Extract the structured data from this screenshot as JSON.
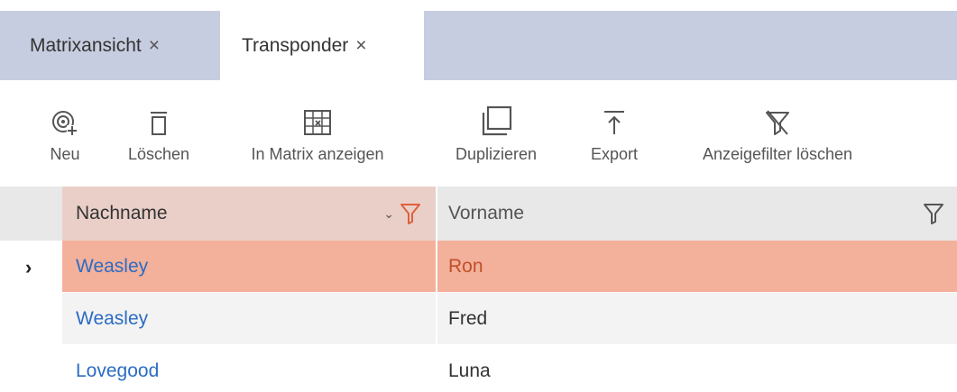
{
  "tabs": [
    {
      "label": "Matrixansicht",
      "close": "×",
      "active": false
    },
    {
      "label": "Transponder",
      "close": "×",
      "active": true
    }
  ],
  "toolbar": {
    "new_label": "Neu",
    "delete_label": "Löschen",
    "show_in_matrix_label": "In Matrix anzeigen",
    "duplicate_label": "Duplizieren",
    "export_label": "Export",
    "clear_filter_label": "Anzeigefilter löschen"
  },
  "grid": {
    "columns": [
      {
        "header": "Nachname",
        "sort": "descending",
        "filter_active": true
      },
      {
        "header": "Vorname",
        "filter_active": false
      }
    ],
    "sort_glyph": "⌄",
    "row_indicator": "›",
    "rows": [
      {
        "last_name": "Weasley",
        "first_name": "Ron",
        "selected": true
      },
      {
        "last_name": "Weasley",
        "first_name": "Fred",
        "selected": false
      },
      {
        "last_name": "Lovegood",
        "first_name": "Luna",
        "selected": false
      }
    ]
  },
  "colors": {
    "tabbar_bg": "#c7cde0",
    "selected_row": "#f3b09a",
    "link_text": "#2b6cc4",
    "filter_active": "#e0603c"
  }
}
